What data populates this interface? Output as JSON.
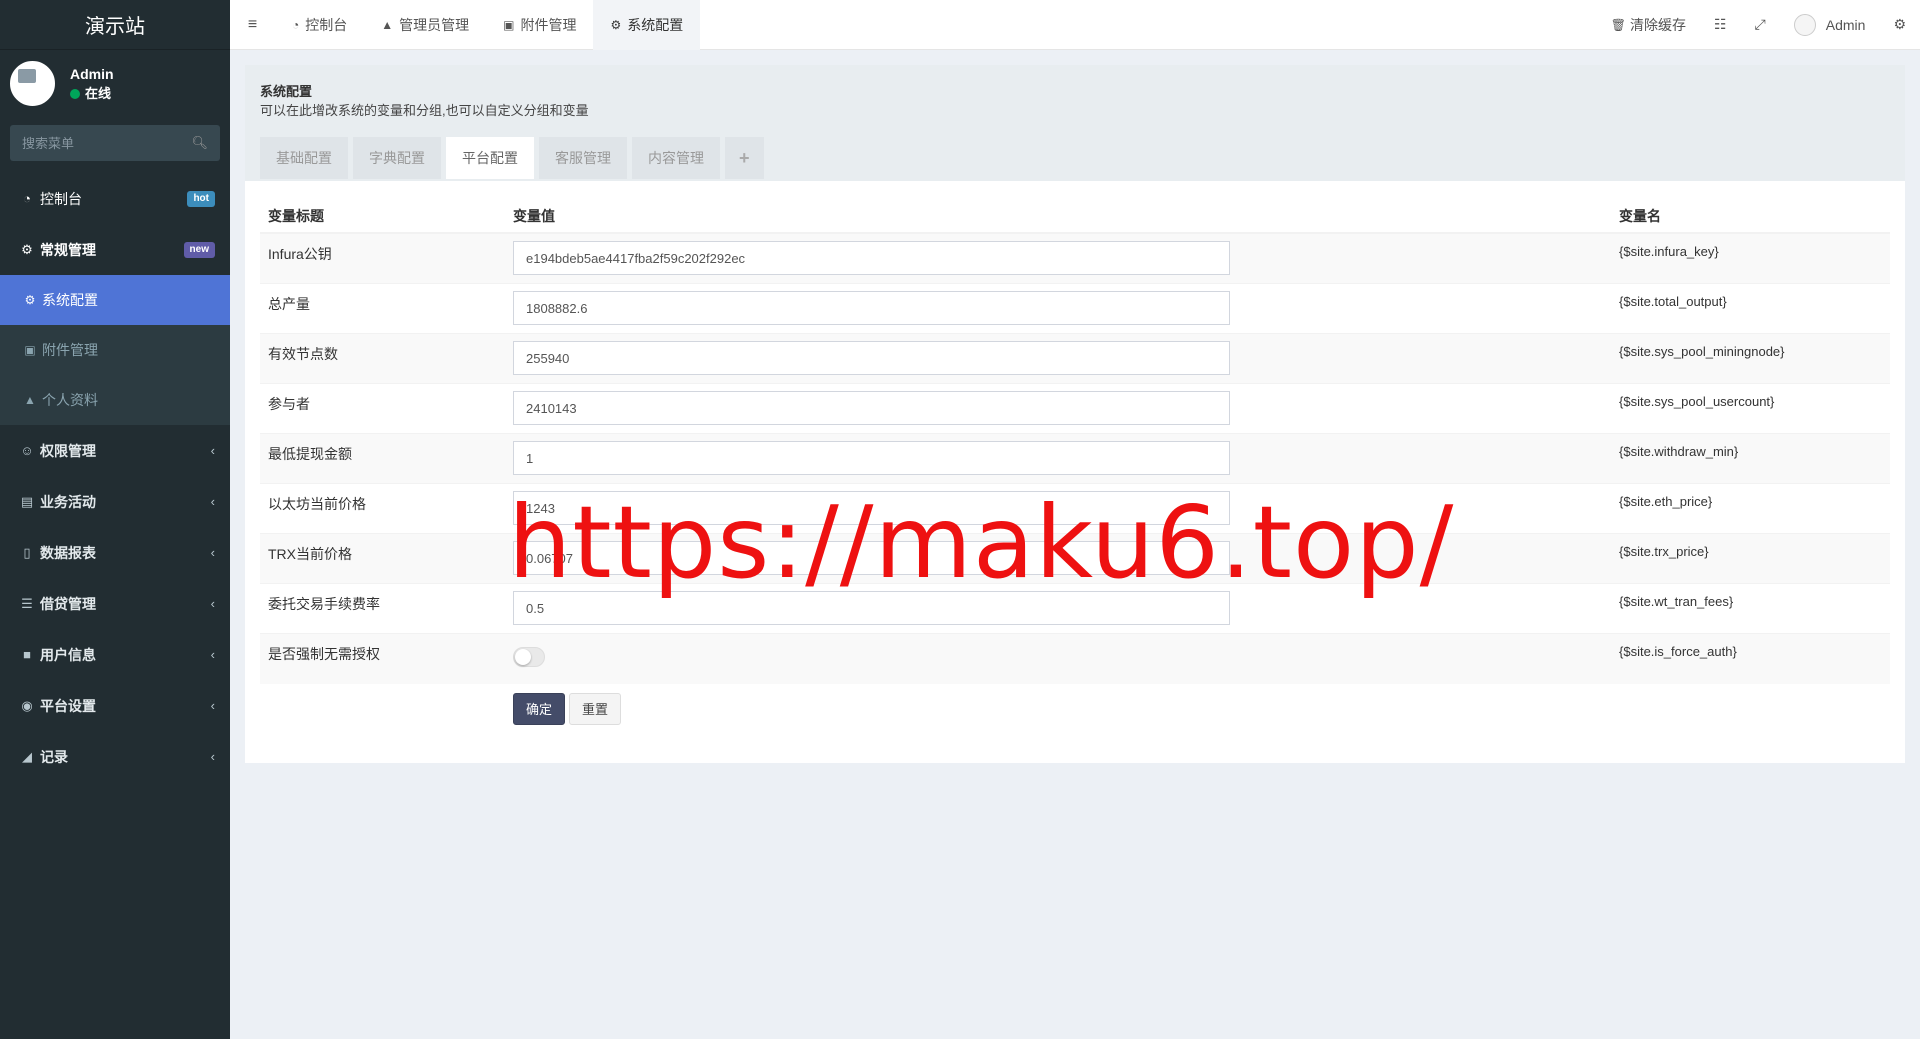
{
  "site_title": "演示站",
  "user": {
    "name": "Admin",
    "status": "在线"
  },
  "sidebar": {
    "search_placeholder": "搜索菜单",
    "items": [
      {
        "label": "控制台",
        "icon": "dashboard-icon",
        "badge": "hot"
      },
      {
        "label": "常规管理",
        "icon": "cogs-icon",
        "badge": "new"
      }
    ],
    "sub_items": [
      {
        "label": "系统配置",
        "icon": "gear-icon",
        "active": true
      },
      {
        "label": "附件管理",
        "icon": "image-file-icon"
      },
      {
        "label": "个人资料",
        "icon": "user-icon"
      }
    ],
    "lower_items": [
      {
        "label": "权限管理",
        "icon": "users-icon"
      },
      {
        "label": "业务活动",
        "icon": "list-alt-icon"
      },
      {
        "label": "数据报表",
        "icon": "file-icon"
      },
      {
        "label": "借贷管理",
        "icon": "list-icon"
      },
      {
        "label": "用户信息",
        "icon": "address-book-icon"
      },
      {
        "label": "平台设置",
        "icon": "dot-circle-icon"
      },
      {
        "label": "记录",
        "icon": "area-chart-icon"
      }
    ]
  },
  "topbar": {
    "tabs": [
      {
        "label": "控制台",
        "icon": "dashboard-icon"
      },
      {
        "label": "管理员管理",
        "icon": "user-icon"
      },
      {
        "label": "附件管理",
        "icon": "image-file-icon"
      },
      {
        "label": "系统配置",
        "icon": "gear-icon",
        "active": true
      }
    ],
    "clear_cache": "清除缓存",
    "user_name": "Admin"
  },
  "panel": {
    "title": "系统配置",
    "description": "可以在此增改系统的变量和分组,也可以自定义分组和变量",
    "tabs": [
      "基础配置",
      "字典配置",
      "平台配置",
      "客服管理",
      "内容管理",
      "+"
    ],
    "active_tab": "平台配置"
  },
  "table": {
    "headers": [
      "变量标题",
      "变量值",
      "变量名"
    ],
    "rows": [
      {
        "title": "Infura公钥",
        "value": "e194bdeb5ae4417fba2f59c202f292ec",
        "name": "{$site.infura_key}"
      },
      {
        "title": "总产量",
        "value": "1808882.6",
        "name": "{$site.total_output}"
      },
      {
        "title": "有效节点数",
        "value": "255940",
        "name": "{$site.sys_pool_miningnode}"
      },
      {
        "title": "参与者",
        "value": "2410143",
        "name": "{$site.sys_pool_usercount}"
      },
      {
        "title": "最低提现金额",
        "value": "1",
        "name": "{$site.withdraw_min}"
      },
      {
        "title": "以太坊当前价格",
        "value": "1243",
        "name": "{$site.eth_price}"
      },
      {
        "title": "TRX当前价格",
        "value": "0.06707",
        "name": "{$site.trx_price}"
      },
      {
        "title": "委托交易手续费率",
        "value": "0.5",
        "name": "{$site.wt_tran_fees}"
      },
      {
        "title": "是否强制无需授权",
        "value_toggle": false,
        "name": "{$site.is_force_auth}"
      }
    ]
  },
  "buttons": {
    "submit": "确定",
    "reset": "重置"
  },
  "watermark": "https://maku6.top/",
  "colors": {
    "sidebar_bg": "#222d32",
    "active_item": "#4f74d6",
    "primary_button": "#444c69",
    "watermark": "#ee1111"
  }
}
